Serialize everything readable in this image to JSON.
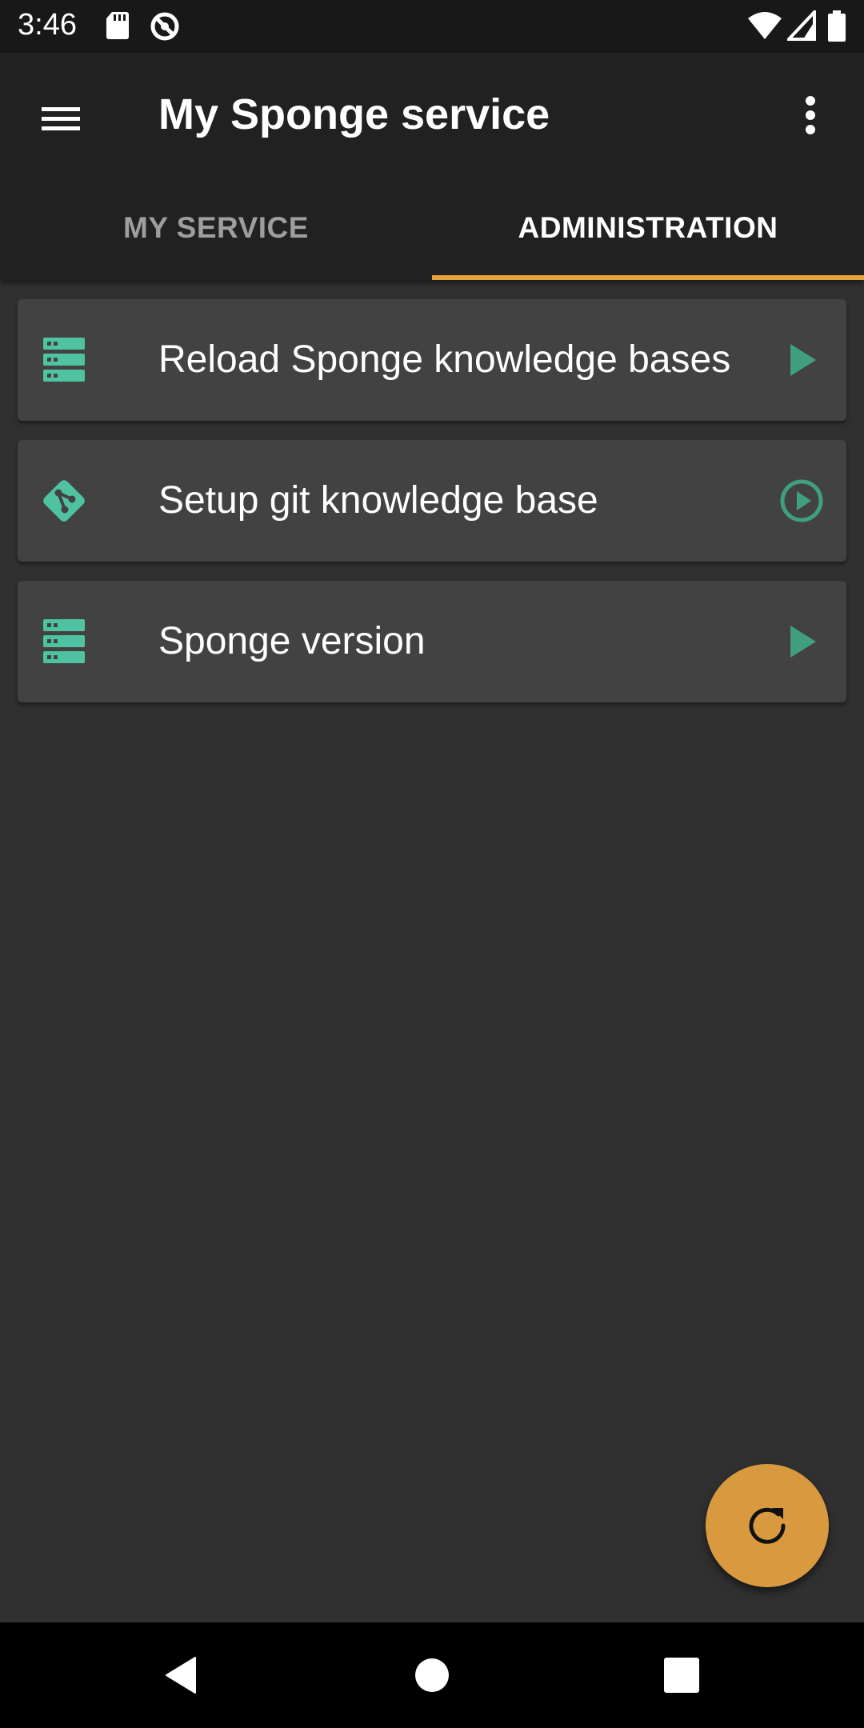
{
  "status_bar": {
    "time": "3:46",
    "icons": [
      "sd-card-icon",
      "sync-icon",
      "wifi-icon",
      "signal-icon",
      "battery-icon"
    ]
  },
  "app_bar": {
    "title": "My Sponge service",
    "menu_icon": "hamburger-menu-icon",
    "more_icon": "more-vert-icon"
  },
  "tabs": [
    {
      "label": "MY SERVICE",
      "selected": false
    },
    {
      "label": "ADMINISTRATION",
      "selected": true
    }
  ],
  "actions": [
    {
      "label": "Reload Sponge knowledge bases",
      "icon": "server-icon",
      "action_icon": "play-arrow-icon"
    },
    {
      "label": "Setup git knowledge base",
      "icon": "git-icon",
      "action_icon": "play-circle-outline-icon"
    },
    {
      "label": "Sponge version",
      "icon": "server-icon",
      "action_icon": "play-arrow-icon"
    }
  ],
  "fab": {
    "icon": "refresh-icon"
  },
  "nav_bar": {
    "icons": [
      "back-icon",
      "home-icon",
      "recents-icon"
    ]
  },
  "colors": {
    "accent": "#e5a13c",
    "fab": "#d9993f",
    "icon_teal": "#4fc3a1",
    "action_green": "#3f9f80",
    "background": "#303030",
    "card": "#424242",
    "app_bar": "#212121"
  }
}
